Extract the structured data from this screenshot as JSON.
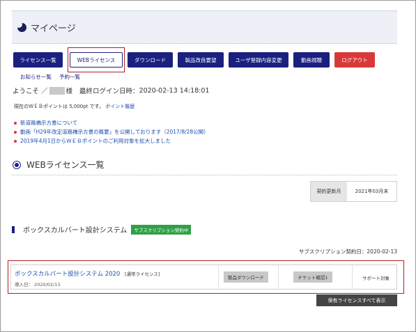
{
  "page": {
    "title": "マイページ"
  },
  "nav": {
    "buttons": [
      {
        "label": "ライセンス一覧"
      },
      {
        "label": "WEBライセンス"
      },
      {
        "label": "ダウンロード"
      },
      {
        "label": "製品改良要望"
      },
      {
        "label": "ユーザ登録内容変更"
      },
      {
        "label": "動画視聴"
      },
      {
        "label": "ログアウト"
      }
    ],
    "sublinks": [
      {
        "label": "お知らせ一覧"
      },
      {
        "label": "予約一覧"
      }
    ]
  },
  "welcome": {
    "greeting": "ようこそ ／",
    "honorific": "様",
    "last_login_label": "最終ログイン日時：",
    "last_login": "2020-02-13 14:18:01"
  },
  "points": {
    "text": "現在のＷＥＢポイントは 5,000pt です。",
    "history_link": "ポイント履歴"
  },
  "news": [
    {
      "text": "新道路橋示方書について"
    },
    {
      "text": "動画「H29年改定道路橋示方書の概要」を公開しております（2017/8/28公開）"
    },
    {
      "text": "2019年4月1日からＷＥＢポイントのご利用対象を拡大しました"
    }
  ],
  "section": {
    "title": "WEBライセンス一覧"
  },
  "renewal": {
    "label": "契約更新月",
    "value": "2021年03月末"
  },
  "product": {
    "name": "ボックスカルバート設計システム",
    "badge": "サブスクリプション契約中",
    "contract_date": "サブスクリプション契約日：2020-02-13"
  },
  "license": {
    "name": "ボックスカルバート設計システム 2020",
    "type": "[通常ライセンス]",
    "install_date": "導入日： 2020/02/13",
    "download_button": "製品ダウンロード",
    "ticket_button": "チケット確認1",
    "support": "サポート対象"
  },
  "show_all_button": "保有ライセンスすべて表示",
  "colors": {
    "nav": "#1a2080",
    "logout": "#d9383a",
    "badge": "#2ea046",
    "highlight": "#b01e1e"
  }
}
